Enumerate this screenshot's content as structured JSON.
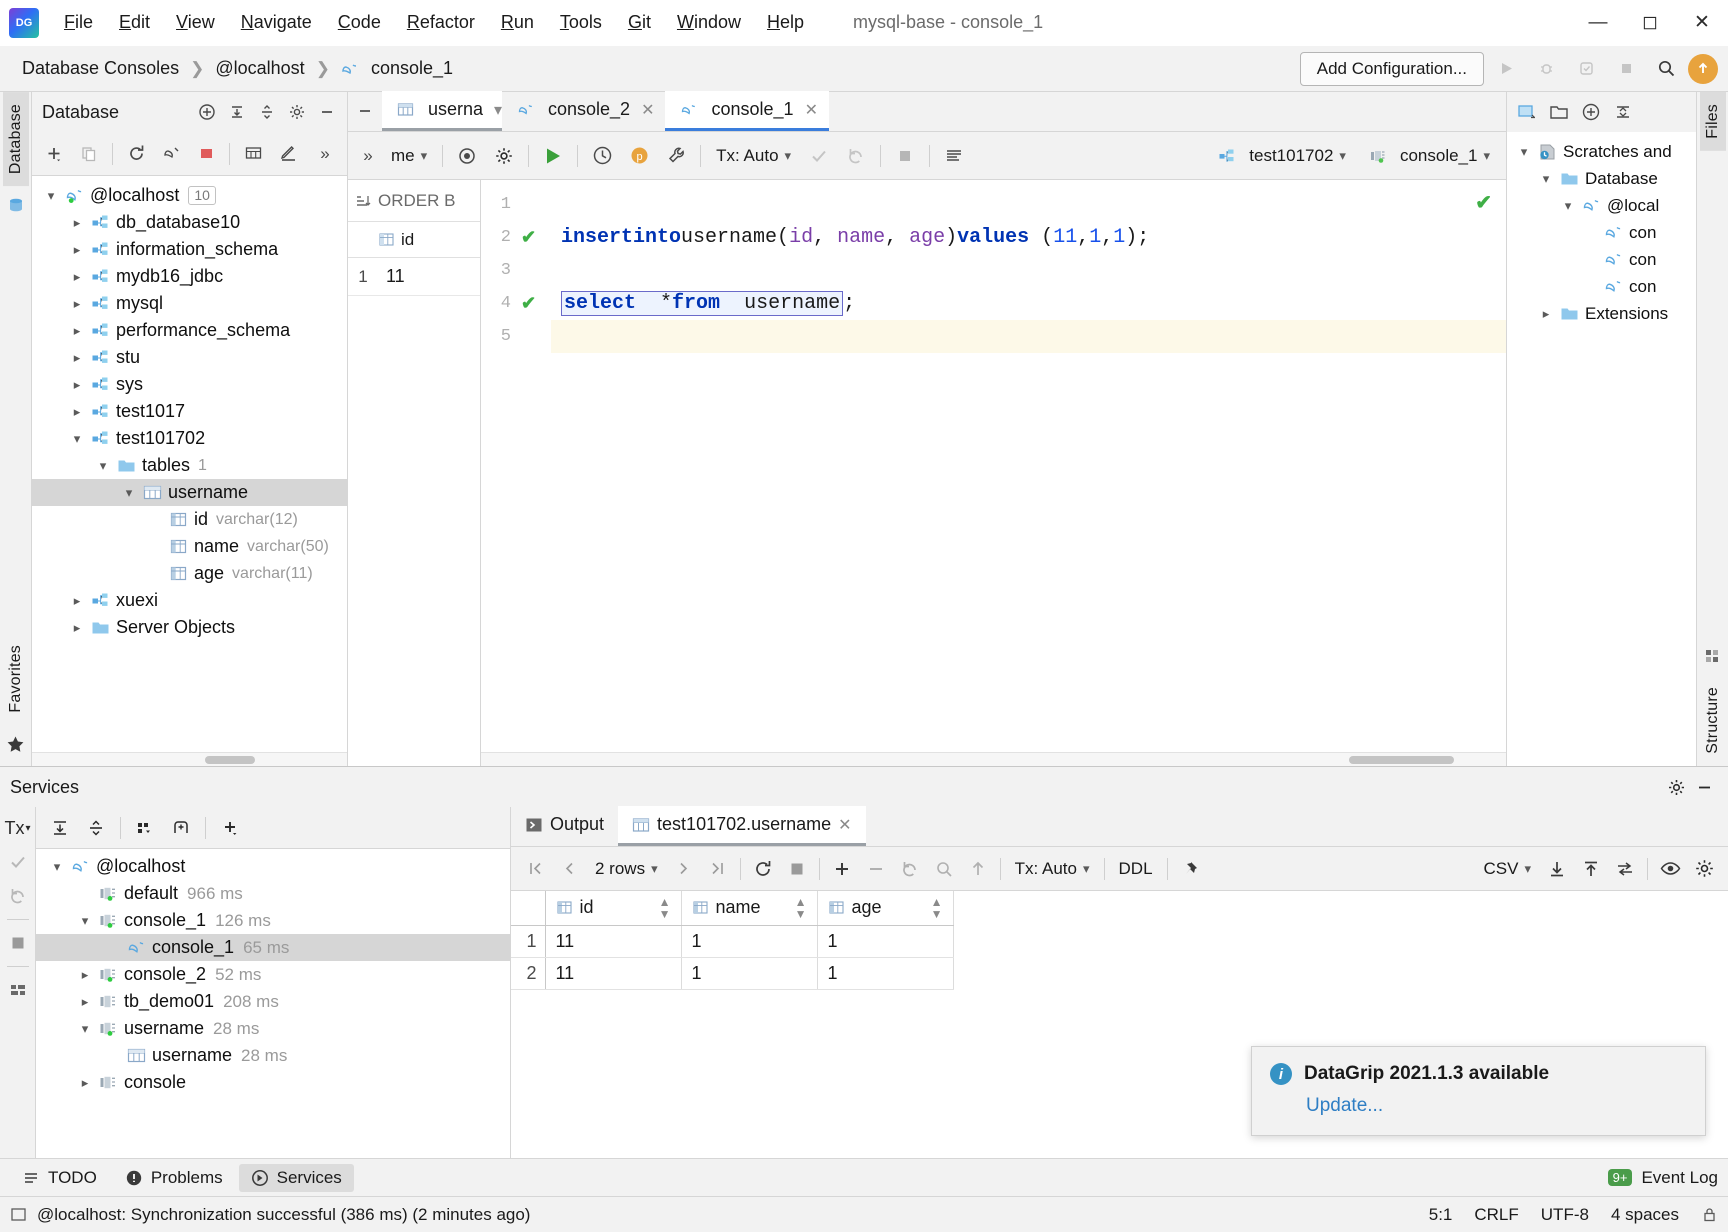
{
  "window": {
    "title": "mysql-base - console_1",
    "minimize": "─",
    "maximize": "☐",
    "close": "✕"
  },
  "menu": [
    {
      "label": "File"
    },
    {
      "label": "Edit"
    },
    {
      "label": "View"
    },
    {
      "label": "Navigate"
    },
    {
      "label": "Code"
    },
    {
      "label": "Refactor"
    },
    {
      "label": "Run"
    },
    {
      "label": "Tools"
    },
    {
      "label": "Git"
    },
    {
      "label": "Window"
    },
    {
      "label": "Help"
    }
  ],
  "navbar": {
    "breadcrumbs": [
      "Database Consoles",
      "@localhost",
      "console_1"
    ],
    "add_configuration": "Add Configuration..."
  },
  "database_panel": {
    "title": "Database",
    "tree": [
      {
        "label": "@localhost",
        "badge": "10",
        "indent": 0,
        "arrow": "down",
        "icon": "mysql-dolphin-icon",
        "connected": true
      },
      {
        "label": "db_database10",
        "indent": 1,
        "arrow": "right",
        "icon": "schema-icon"
      },
      {
        "label": "information_schema",
        "indent": 1,
        "arrow": "right",
        "icon": "schema-icon"
      },
      {
        "label": "mydb16_jdbc",
        "indent": 1,
        "arrow": "right",
        "icon": "schema-icon"
      },
      {
        "label": "mysql",
        "indent": 1,
        "arrow": "right",
        "icon": "schema-icon"
      },
      {
        "label": "performance_schema",
        "indent": 1,
        "arrow": "right",
        "icon": "schema-icon"
      },
      {
        "label": "stu",
        "indent": 1,
        "arrow": "right",
        "icon": "schema-icon"
      },
      {
        "label": "sys",
        "indent": 1,
        "arrow": "right",
        "icon": "schema-icon"
      },
      {
        "label": "test1017",
        "indent": 1,
        "arrow": "right",
        "icon": "schema-icon"
      },
      {
        "label": "test101702",
        "indent": 1,
        "arrow": "down",
        "icon": "schema-icon"
      },
      {
        "label": "tables",
        "sub": "1",
        "indent": 2,
        "arrow": "down",
        "icon": "folder-icon"
      },
      {
        "label": "username",
        "indent": 3,
        "arrow": "down",
        "icon": "table-icon",
        "selected": true
      },
      {
        "label": "id",
        "sub": "varchar(12)",
        "indent": 4,
        "arrow": "none",
        "icon": "column-icon"
      },
      {
        "label": "name",
        "sub": "varchar(50)",
        "indent": 4,
        "arrow": "none",
        "icon": "column-icon"
      },
      {
        "label": "age",
        "sub": "varchar(11)",
        "indent": 4,
        "arrow": "none",
        "icon": "column-icon"
      },
      {
        "label": "xuexi",
        "indent": 1,
        "arrow": "right",
        "icon": "schema-icon"
      },
      {
        "label": "Server Objects",
        "indent": 1,
        "arrow": "right",
        "icon": "folder-icon"
      }
    ]
  },
  "editor": {
    "tabs": [
      {
        "label": "userna",
        "icon": "table-icon",
        "type": "partial",
        "active": false
      },
      {
        "label": "console_2",
        "icon": "mysql-dolphin-icon",
        "type": "console",
        "active": false
      },
      {
        "label": "console_1",
        "icon": "mysql-dolphin-icon",
        "type": "console",
        "active": true
      }
    ],
    "toolbar": {
      "overflow": "»",
      "name_chip": "me",
      "tx_label": "Tx: Auto",
      "schema_chip": "test101702",
      "session_chip": "console_1"
    },
    "side_panel": {
      "header": "ORDER B",
      "name_chip": "me",
      "column_header": "id",
      "rows": [
        {
          "num": "1",
          "value": "11"
        }
      ]
    },
    "lines": [
      {
        "num": "1",
        "status": "none",
        "text": ""
      },
      {
        "num": "2",
        "status": "ok",
        "text": "insert  into username(id, name, age)values (11,1,1);"
      },
      {
        "num": "3",
        "status": "none",
        "text": ""
      },
      {
        "num": "4",
        "status": "ok",
        "text": "select  *from  username;"
      },
      {
        "num": "5",
        "status": "none",
        "text": "",
        "highlighted": true
      }
    ]
  },
  "files_panel": {
    "vtab": "Files",
    "tree": [
      {
        "label": "Scratches and",
        "indent": 0,
        "arrow": "down",
        "icon": "scratches-icon"
      },
      {
        "label": "Database",
        "indent": 1,
        "arrow": "down",
        "icon": "folder-icon"
      },
      {
        "label": "@local",
        "indent": 2,
        "arrow": "down",
        "icon": "mysql-dolphin-icon"
      },
      {
        "label": "con",
        "indent": 3,
        "arrow": "none",
        "icon": "mysql-dolphin-icon"
      },
      {
        "label": "con",
        "indent": 3,
        "arrow": "none",
        "icon": "mysql-dolphin-icon"
      },
      {
        "label": "con",
        "indent": 3,
        "arrow": "none",
        "icon": "mysql-dolphin-icon"
      },
      {
        "label": "Extensions",
        "indent": 1,
        "arrow": "right",
        "icon": "folder-icon"
      }
    ]
  },
  "left_strips": {
    "database_tab": "Database",
    "favorites_tab": "Favorites",
    "structure_tab": "Structure"
  },
  "services": {
    "title": "Services",
    "tx_label": "Tx",
    "tree": [
      {
        "label": "@localhost",
        "indent": 0,
        "arrow": "down",
        "icon": "mysql-dolphin-icon"
      },
      {
        "label": "default",
        "ms": "966 ms",
        "indent": 1,
        "arrow": "none",
        "icon": "session-icon",
        "connected": true
      },
      {
        "label": "console_1",
        "ms": "126 ms",
        "indent": 1,
        "arrow": "down",
        "icon": "session-icon",
        "connected": true
      },
      {
        "label": "console_1",
        "ms": "65 ms",
        "indent": 2,
        "arrow": "none",
        "icon": "mysql-dolphin-icon",
        "selected": true
      },
      {
        "label": "console_2",
        "ms": "52 ms",
        "indent": 1,
        "arrow": "right",
        "icon": "session-icon",
        "connected": true
      },
      {
        "label": "tb_demo01",
        "ms": "208 ms",
        "indent": 1,
        "arrow": "right",
        "icon": "session-icon"
      },
      {
        "label": "username",
        "ms": "28 ms",
        "indent": 1,
        "arrow": "down",
        "icon": "session-icon",
        "connected": true
      },
      {
        "label": "username",
        "ms": "28 ms",
        "indent": 2,
        "arrow": "none",
        "icon": "table-icon"
      },
      {
        "label": "console",
        "indent": 1,
        "arrow": "right",
        "icon": "session-icon"
      }
    ],
    "result_tabs": [
      {
        "label": "Output",
        "icon": "output-icon",
        "active": false,
        "closable": false
      },
      {
        "label": "test101702.username",
        "icon": "table-icon",
        "active": true,
        "closable": true
      }
    ],
    "grid_toolbar": {
      "rows_label": "2 rows",
      "tx_label": "Tx: Auto",
      "ddl_label": "DDL",
      "csv_label": "CSV"
    }
  },
  "grid_data": {
    "columns": [
      "id",
      "name",
      "age"
    ],
    "rows": [
      {
        "num": "1",
        "cells": [
          "11",
          "1",
          "1"
        ]
      },
      {
        "num": "2",
        "cells": [
          "11",
          "1",
          "1"
        ]
      }
    ]
  },
  "notification": {
    "title": "DataGrip 2021.1.3 available",
    "link": "Update..."
  },
  "toolwindows": [
    {
      "label": "TODO",
      "icon": "todo-icon",
      "active": false
    },
    {
      "label": "Problems",
      "icon": "problems-icon",
      "active": false
    },
    {
      "label": "Services",
      "icon": "services-icon",
      "active": true
    }
  ],
  "event_log": {
    "label": "Event Log",
    "badge": "9+"
  },
  "statusbar": {
    "message": "@localhost: Synchronization successful (386 ms) (2 minutes ago)",
    "caret": "5:1",
    "line_sep": "CRLF",
    "encoding": "UTF-8",
    "indent": "4 spaces"
  },
  "colors": {
    "accent_blue": "#3a7ddc",
    "keyword_blue": "#0033b3",
    "success_green": "#3faf46",
    "link_blue": "#2e7ec4",
    "selection_gray": "#d6d6d6"
  }
}
